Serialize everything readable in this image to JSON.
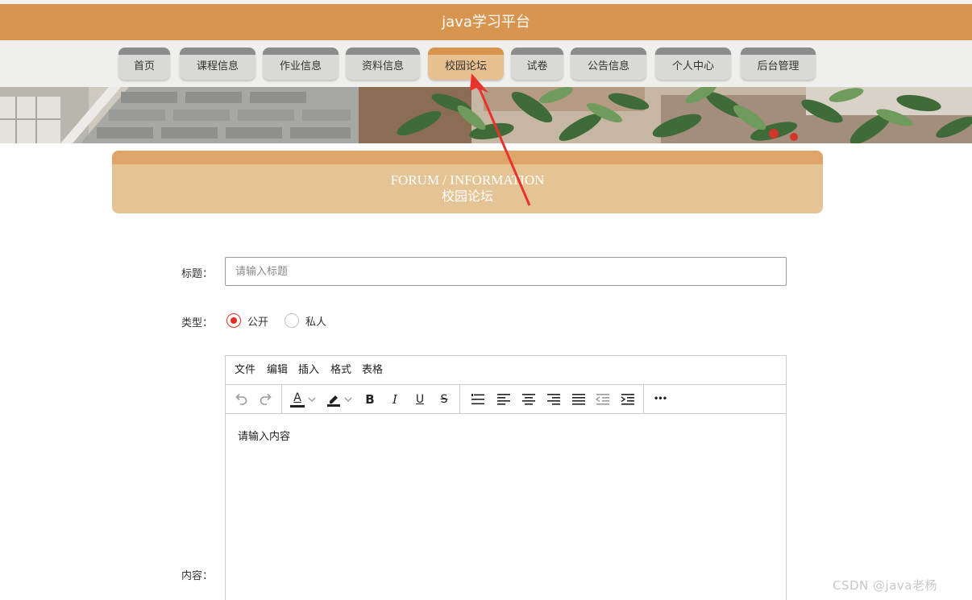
{
  "app": {
    "title": "java学习平台"
  },
  "nav": {
    "items": [
      {
        "label": "首页"
      },
      {
        "label": "课程信息"
      },
      {
        "label": "作业信息"
      },
      {
        "label": "资料信息"
      },
      {
        "label": "校园论坛"
      },
      {
        "label": "试卷"
      },
      {
        "label": "公告信息"
      },
      {
        "label": "个人中心"
      },
      {
        "label": "后台管理"
      }
    ],
    "active": "校园论坛"
  },
  "section": {
    "en_title": "FORUM / INFORMATION",
    "cn_title": "校园论坛"
  },
  "form": {
    "title_label": "标题：",
    "title_placeholder": "请输入标题",
    "type_label": "类型：",
    "type_options": [
      {
        "label": "公开",
        "checked": true
      },
      {
        "label": "私人",
        "checked": false
      }
    ],
    "content_label": "内容："
  },
  "editor": {
    "menus": [
      "文件",
      "编辑",
      "插入",
      "格式",
      "表格"
    ],
    "toolbar": {
      "font_color_glyph": "A",
      "bold_glyph": "B",
      "italic_glyph": "I",
      "underline_glyph": "U",
      "strike_glyph": "S",
      "more_glyph": "•••"
    },
    "content": "请输入内容"
  },
  "colors": {
    "brand": "#d8954f",
    "active_tab": "#e8bf8e",
    "section_header": "#e4c394",
    "radio_checked": "#e02e24",
    "annotation_arrow": "#e8322b"
  },
  "watermark": "CSDN @java老杨"
}
